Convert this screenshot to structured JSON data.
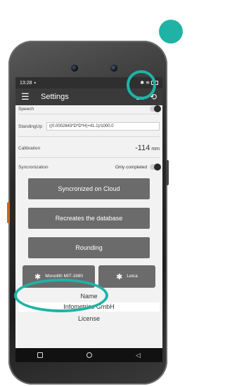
{
  "statusbar": {
    "time": "13:28",
    "left_icon": "sim-card-icon",
    "right_icons": [
      "bluetooth-icon",
      "wifi-icon",
      "battery-icon"
    ]
  },
  "appbar": {
    "title": "Settings",
    "menu_icon": "hamburger-menu-icon",
    "actions": [
      "cloud-download-icon",
      "sync-icon"
    ]
  },
  "settings": {
    "speech_label": "Speech",
    "standingup_label": "StandingUp",
    "standingup_formula": "((0.0002843*D*D*H)+41.1)/1000.0",
    "calibration_label": "Calibration",
    "calibration_value": "-114",
    "calibration_unit": "mm",
    "sync_label": "Syncronization",
    "sync_value": "Only completed"
  },
  "buttons": {
    "sync_cloud": "Syncronized on Cloud",
    "recreate_db": "Recreates the database",
    "rounding": "Rounding",
    "bt_device1": "Monolith MIT-1680",
    "bt_device2": "Leica"
  },
  "info": {
    "name_title": "Name",
    "name_value": "Infometrics GmbH",
    "license_title": "License"
  },
  "navbar": [
    "recents-button",
    "home-button",
    "back-button"
  ],
  "colors": {
    "highlight": "#1fb3a6",
    "appbar": "#3a3a3a",
    "button": "#6b6b6b"
  }
}
